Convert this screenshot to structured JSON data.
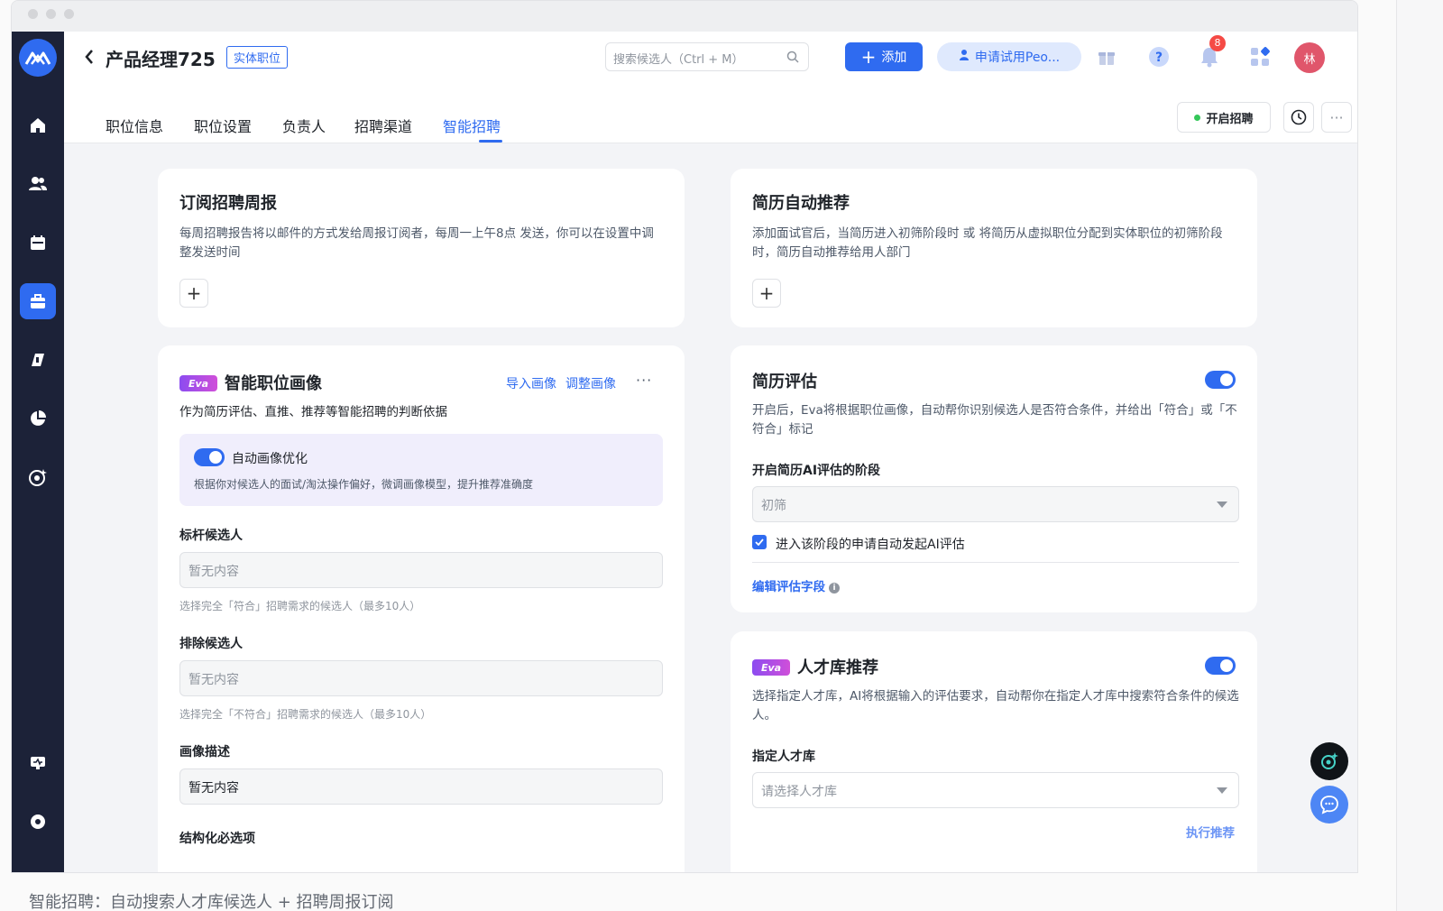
{
  "header": {
    "back_icon": "chevron-left-icon",
    "title": "产品经理725",
    "title_tag": "实体职位",
    "search_placeholder": "搜索候选人（Ctrl + M）",
    "add_label": "添加",
    "trial_label": "申请试用Peo...",
    "notification_count": "8",
    "avatar_text": "林"
  },
  "tabs": [
    {
      "label": "职位信息"
    },
    {
      "label": "职位设置"
    },
    {
      "label": "负责人"
    },
    {
      "label": "招聘渠道"
    },
    {
      "label": "智能招聘",
      "active": true
    }
  ],
  "actions": {
    "open_recruit_label": "开启招聘"
  },
  "cards": {
    "weekly": {
      "title": "订阅招聘周报",
      "desc": "每周招聘报告将以邮件的方式发给周报订阅者，每周一上午8点 发送，你可以在设置中调整发送时间"
    },
    "auto_recommend": {
      "title": "简历自动推荐",
      "desc": "添加面试官后，当简历进入初筛阶段时 或 将简历从虚拟职位分配到实体职位的初筛阶段时，简历自动推荐给用人部门"
    },
    "persona": {
      "eva_badge": "Eva",
      "title": "智能职位画像",
      "import_label": "导入画像",
      "adjust_label": "调整画像",
      "desc": "作为简历评估、直推、推荐等智能招聘的判断依据",
      "auto_opt_label": "自动画像优化",
      "auto_opt_enabled": true,
      "auto_opt_desc": "根据你对候选人的面试/淘汰操作偏好，微调画像模型，提升推荐准确度",
      "benchmark_label": "标杆候选人",
      "benchmark_value": "暂无内容",
      "benchmark_hint": "选择完全「符合」招聘需求的候选人（最多10人）",
      "exclude_label": "排除候选人",
      "exclude_value": "暂无内容",
      "exclude_hint": "选择完全「不符合」招聘需求的候选人（最多10人）",
      "describe_label": "画像描述",
      "describe_value": "暂无内容",
      "structured_label": "结构化必选项"
    },
    "evaluation": {
      "title": "简历评估",
      "enabled": true,
      "desc": "开启后，Eva将根据职位画像，自动帮你识别候选人是否符合条件，并给出「符合」或「不符合」标记",
      "stage_label": "开启简历AI评估的阶段",
      "stage_value": "初筛",
      "auto_eval_label": "进入该阶段的申请自动发起AI评估",
      "auto_eval_checked": true,
      "edit_fields_label": "编辑评估字段"
    },
    "talent": {
      "eva_badge": "Eva",
      "title": "人才库推荐",
      "enabled": true,
      "desc": "选择指定人才库，AI将根据输入的评估要求，自动帮你在指定人才库中搜索符合条件的候选人。",
      "pool_label": "指定人才库",
      "pool_placeholder": "请选择人才库",
      "run_label": "执行推荐"
    }
  },
  "caption": "智能招聘：自动搜索人才库候选人 + 招聘周报订阅",
  "colors": {
    "accent": "#2f6bf0",
    "sidebar": "#1c2238",
    "badge": "#f54a45",
    "avatar": "#e0566b"
  }
}
